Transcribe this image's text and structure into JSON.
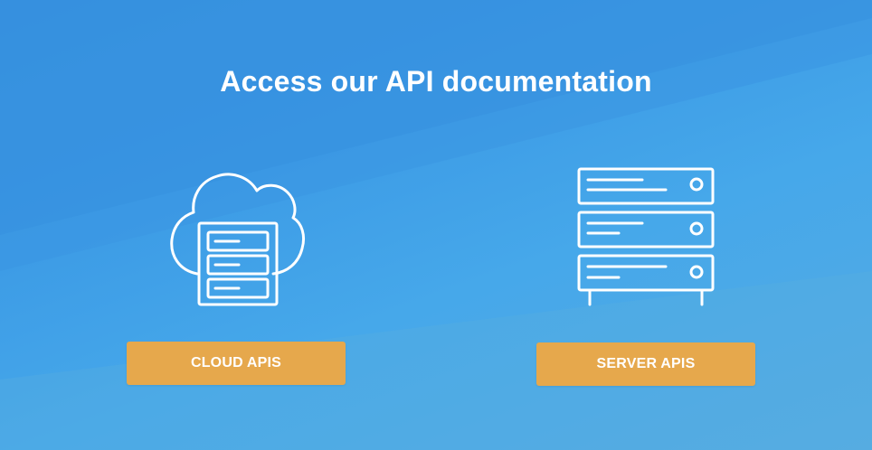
{
  "hero": {
    "title": "Access our API documentation"
  },
  "cards": [
    {
      "icon": "cloud-server-icon",
      "button_label": "CLOUD APIS"
    },
    {
      "icon": "server-rack-icon",
      "button_label": "SERVER APIS"
    }
  ],
  "colors": {
    "background": "#3d9ce6",
    "button": "#e6a84c",
    "text": "#ffffff"
  }
}
